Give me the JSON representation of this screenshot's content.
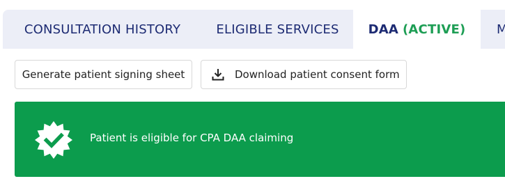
{
  "tabs": [
    {
      "label": "CONSULTATION HISTORY",
      "suffix": ""
    },
    {
      "label": "ELIGIBLE SERVICES",
      "suffix": ""
    },
    {
      "label": "DAA",
      "suffix": "(ACTIVE)"
    },
    {
      "label": "M",
      "suffix": ""
    }
  ],
  "actions": {
    "signing_sheet_label": "Generate patient signing sheet",
    "consent_form_label": "Download patient consent form",
    "consent_form_icon": "download-icon"
  },
  "banner": {
    "message": "Patient is eligible for CPA DAA claiming",
    "icon": "verified-badge-icon"
  },
  "colors": {
    "tab_background": "#eceef7",
    "tab_text": "#1d2b73",
    "active_accent": "#1e9e55",
    "banner_background": "#0c9c4d"
  }
}
